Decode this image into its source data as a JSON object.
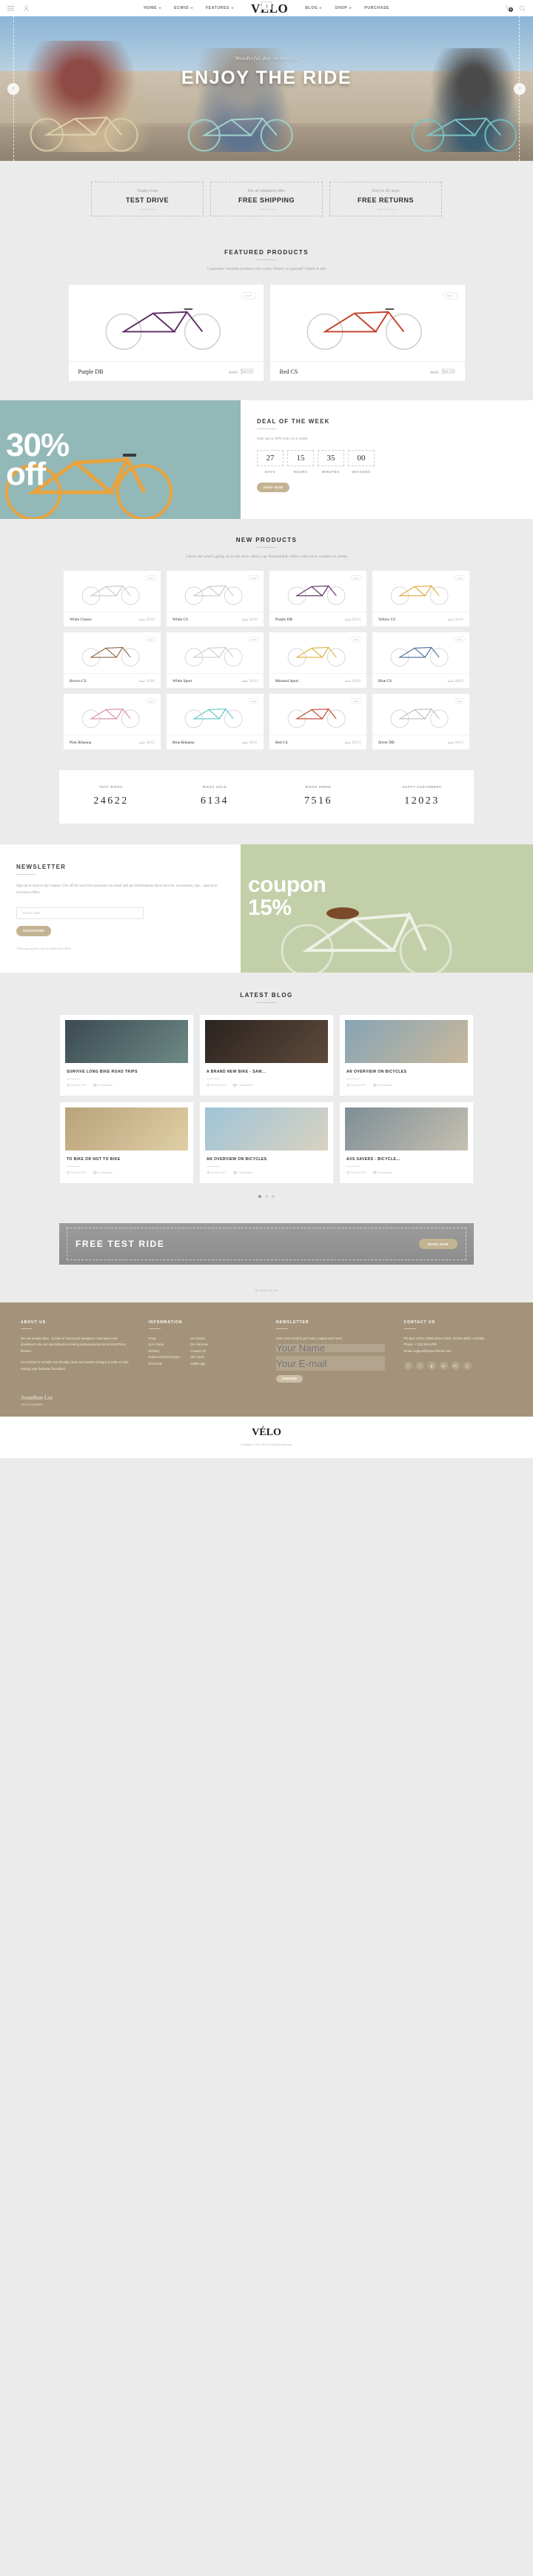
{
  "header": {
    "logo": "VÉLO",
    "nav_left": [
      "HOME",
      "ECWID",
      "FEATURES"
    ],
    "nav_right": [
      "BLOG",
      "SHOP",
      "PURCHASE"
    ],
    "cart_count": "0",
    "icons": {
      "menu": "menu-icon",
      "user": "user-icon",
      "cart": "cart-icon",
      "search": "search-icon",
      "download": "download-icon"
    }
  },
  "hero": {
    "subtitle": "Wonderful day in the city",
    "title": "ENJOY THE RIDE",
    "prev": "‹",
    "next": "›"
  },
  "features": [
    {
      "small": "Totally Free",
      "big": "TEST DRIVE"
    },
    {
      "small": "For all standard offer",
      "big": "FREE SHIPPING"
    },
    {
      "small": "Only in 30 days",
      "big": "FREE RETURNS"
    }
  ],
  "featured": {
    "title": "FEATURED PRODUCTS",
    "desc": "Customers' favorite products this week. What's so special? Check it out!",
    "tag": "SALE",
    "items": [
      {
        "name": "Purple DB",
        "old": "$700",
        "price": "$650"
      },
      {
        "name": "Red CS",
        "old": "$800",
        "price": "$659"
      }
    ]
  },
  "deal": {
    "percent": "30%",
    "off": "off",
    "title": "DEAL OF THE WEEK",
    "subtitle": "Sale up to 30% only in a week",
    "button": "SHOP NOW",
    "countdown": [
      {
        "value": "27",
        "label": "DAYS"
      },
      {
        "value": "15",
        "label": "HOURS"
      },
      {
        "value": "35",
        "label": "MINUTES"
      },
      {
        "value": "00",
        "label": "SECONDS"
      }
    ]
  },
  "new_products": {
    "title": "NEW PRODUCTS",
    "desc": "Check out what's going on in the store. Hurry up! Remarkable offers sold out in couples of weeks",
    "tag": "NEW",
    "items": [
      {
        "name": "White Classic",
        "old": "$600",
        "price": "$560"
      },
      {
        "name": "White CS",
        "old": "$600",
        "price": "$560"
      },
      {
        "name": "Purple DB",
        "old": "$700",
        "price": "$650"
      },
      {
        "name": "Yellow CS",
        "old": "$600",
        "price": "$560"
      },
      {
        "name": "Brown CS",
        "old": "$600",
        "price": "$560"
      },
      {
        "name": "White Sport",
        "old": "$900",
        "price": "$850"
      },
      {
        "name": "Mustard Sport",
        "old": "$700",
        "price": "$660"
      },
      {
        "name": "Blue CS",
        "old": "$700",
        "price": "$690"
      },
      {
        "name": "Pink Rihanna",
        "old": "$650",
        "price": "$605"
      },
      {
        "name": "Blue Rihanna",
        "old": "$650",
        "price": "$605"
      },
      {
        "name": "Red CS",
        "old": "$800",
        "price": "$659"
      },
      {
        "name": "Silver DB",
        "old": "$650",
        "price": "$605"
      }
    ]
  },
  "stats": [
    {
      "label": "TEST RIDES",
      "value": "24622"
    },
    {
      "label": "BIKES SOLD",
      "value": "6134"
    },
    {
      "label": "BIKES HIRED",
      "value": "7516"
    },
    {
      "label": "HAPPY CUSTOMERS",
      "value": "12023"
    }
  ],
  "newsletter": {
    "title": "NEWSLETTER",
    "desc": "Sign up to receive the coupon 15% off for your first purchase via email and get informations about bicycle, accessories, tips... and more exclusive offers.",
    "placeholder": "Your E-mail",
    "button": "SUBSCRIBE",
    "note": "*Discount applies only on orders over $100",
    "coupon_line1": "coupon",
    "coupon_line2": "15%"
  },
  "blog": {
    "title": "LATEST BLOG",
    "posts": [
      {
        "title": "SURVIVE LONG BIKE ROAD TRIPS",
        "date": "09 June 2017",
        "comments": "2 Comments"
      },
      {
        "title": "A BRAND NEW BIKE - SAM...",
        "date": "09 June 2017",
        "comments": "2 Comments"
      },
      {
        "title": "AN OVERVIEW ON BICYCLES",
        "date": "09 June 2017",
        "comments": "2 Comments"
      },
      {
        "title": "TO BIKE OR NOT TO BIKE",
        "date": "09 June 2017",
        "comments": "2 Comments"
      },
      {
        "title": "AN OVERVIEW ON BICYCLES",
        "date": "09 June 2017",
        "comments": "2 Comments"
      },
      {
        "title": "AXS SAVERS - BICYCLE...",
        "date": "09 June 2017",
        "comments": "2 Comments"
      }
    ]
  },
  "test_ride": {
    "text": "FREE TEST RIDE",
    "button": "BOOK NOW"
  },
  "bottom_note": "Be Social with Us",
  "footer": {
    "columns": [
      {
        "heading": "ABOUT US",
        "text": "We are Suntek store - a team of motorcycle designers, mechanics and developers who are specialized in creating professional premium WordPress themes.",
        "text2": "Our mission is to build user-friendly, clean and modern designs in order to help making your business flourished."
      },
      {
        "heading": "INFORMATION",
        "links_left": [
          "FAQs",
          "Size Guide",
          "Delivery",
          "Return and Exchanges",
          "Discounts"
        ],
        "links_right": [
          "Our Stores",
          "Our Services",
          "Contact Us",
          "Gift Cards",
          "mobile app"
        ]
      },
      {
        "heading": "NEWSLETTER",
        "desc": "Enter your email to get news, coupon and more!",
        "placeholder1": "Your Name",
        "placeholder2": "Your E-mail",
        "button": "SUBSCRIBE"
      },
      {
        "heading": "CONTACT US",
        "address": "PO Box 17512 Collins Street West, Victoria 8007, Australia",
        "phone": "Phone: + (12) 345 6789",
        "email": "Email: support@suntechstore.com"
      }
    ],
    "signature": "Jonathan Lee",
    "signature_label": "CEO & FOUNDER",
    "social": [
      "f",
      "t",
      "g",
      "p",
      "in",
      "y"
    ],
    "logo": "VÉLO",
    "copyright": "Copyright © 2017 VÉLO. All rights reserved."
  }
}
